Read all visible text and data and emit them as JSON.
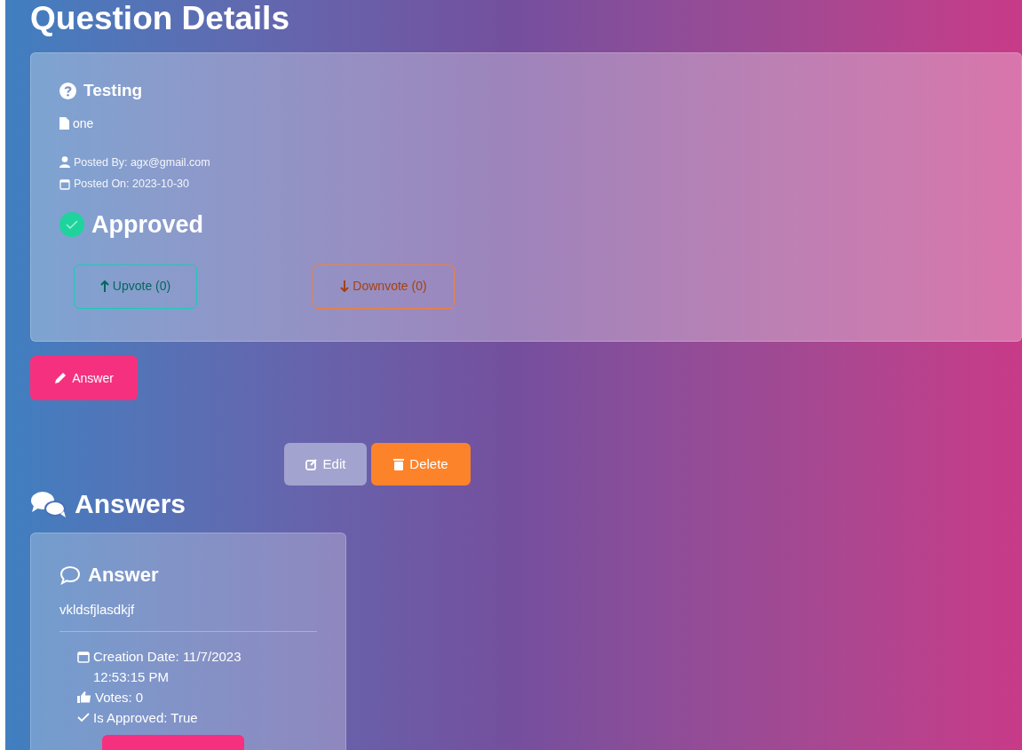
{
  "page_title": "Question Details",
  "question": {
    "title": "Testing",
    "body": "one",
    "posted_by": "Posted By: agx@gmail.com",
    "posted_on": "Posted On: 2023-10-30",
    "status": "Approved",
    "votes": [
      {
        "kind": "up",
        "label": "Upvote (0)"
      },
      {
        "kind": "down",
        "label": "Downvote (0)"
      }
    ]
  },
  "answer_button": "Answer",
  "actions": [
    {
      "kind": "edit",
      "label": "Edit"
    },
    {
      "kind": "delete",
      "label": "Delete"
    }
  ],
  "answers_heading": "Answers",
  "answers": [
    {
      "title": "Answer",
      "body": "vkldsfjlasdkjf",
      "creation_date": "Creation Date: 11/7/2023 12:53:15 PM",
      "votes": "Votes: 0",
      "approved": "Is Approved: True"
    }
  ]
}
